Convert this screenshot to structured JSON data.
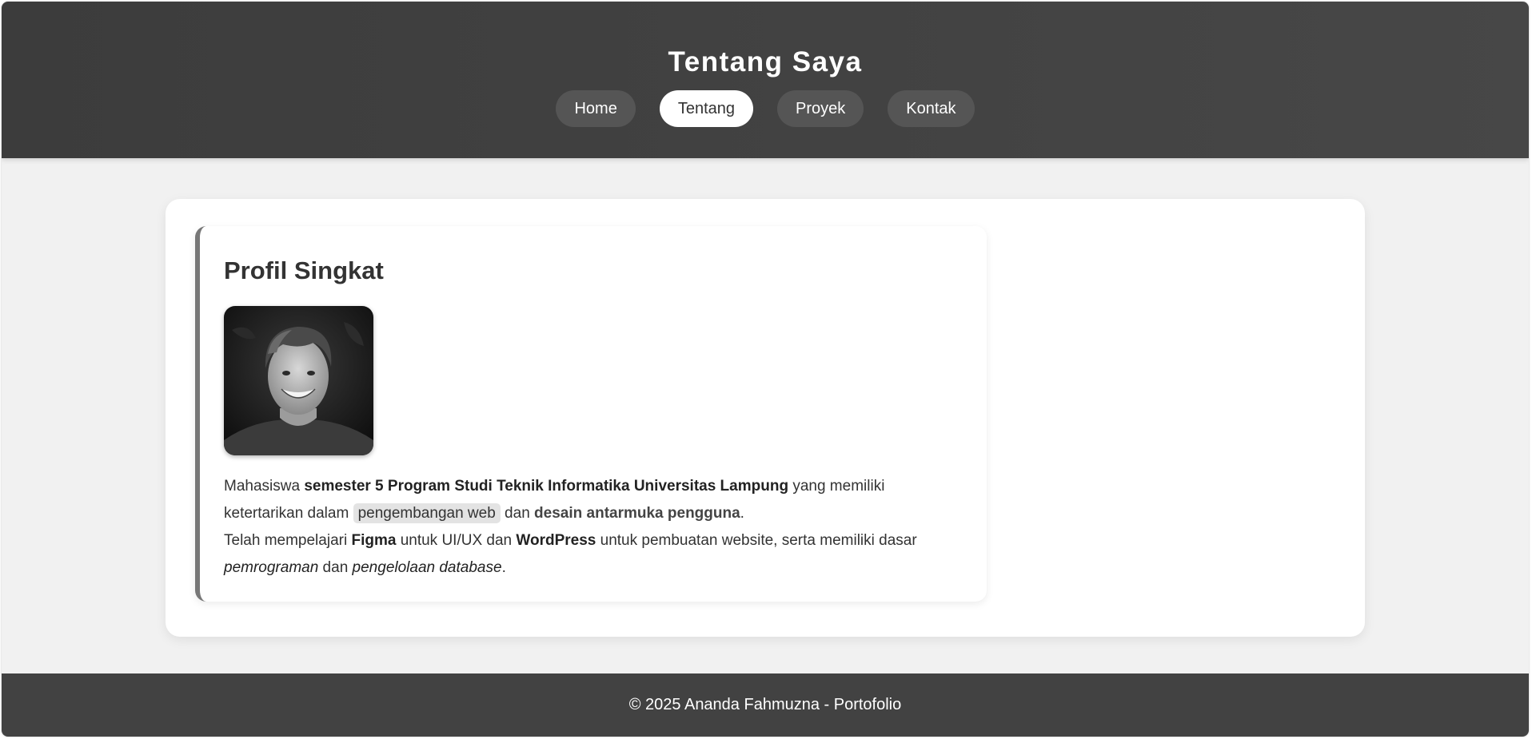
{
  "header": {
    "title": "Tentang Saya",
    "nav": [
      {
        "label": "Home",
        "active": false
      },
      {
        "label": "Tentang",
        "active": true
      },
      {
        "label": "Proyek",
        "active": false
      },
      {
        "label": "Kontak",
        "active": false
      }
    ]
  },
  "profile": {
    "title": "Profil Singkat",
    "photo_icon": "profile-photo",
    "bio": {
      "p1_a": "Mahasiswa ",
      "p1_b": "semester 5 Program Studi Teknik Informatika Universitas Lampung",
      "p1_c": " yang memiliki ketertarikan dalam ",
      "p1_tag": "pengembangan web",
      "p1_d": " dan ",
      "p1_e": "desain antarmuka pengguna",
      "p1_f": ".",
      "p2_a": "Telah mempelajari ",
      "p2_b": "Figma",
      "p2_c": " untuk UI/UX dan ",
      "p2_d": "WordPress",
      "p2_e": " untuk pembuatan website, serta memiliki dasar ",
      "p2_f": "pemrograman",
      "p2_g": " dan ",
      "p2_h": "pengelolaan database",
      "p2_i": "."
    }
  },
  "footer": {
    "text": "© 2025 Ananda Fahmuzna - Portofolio"
  },
  "colors": {
    "header_bg": "#3c3c3c",
    "page_bg": "#f1f1f1",
    "accent_border": "#777777",
    "footer_bg": "#424242"
  }
}
